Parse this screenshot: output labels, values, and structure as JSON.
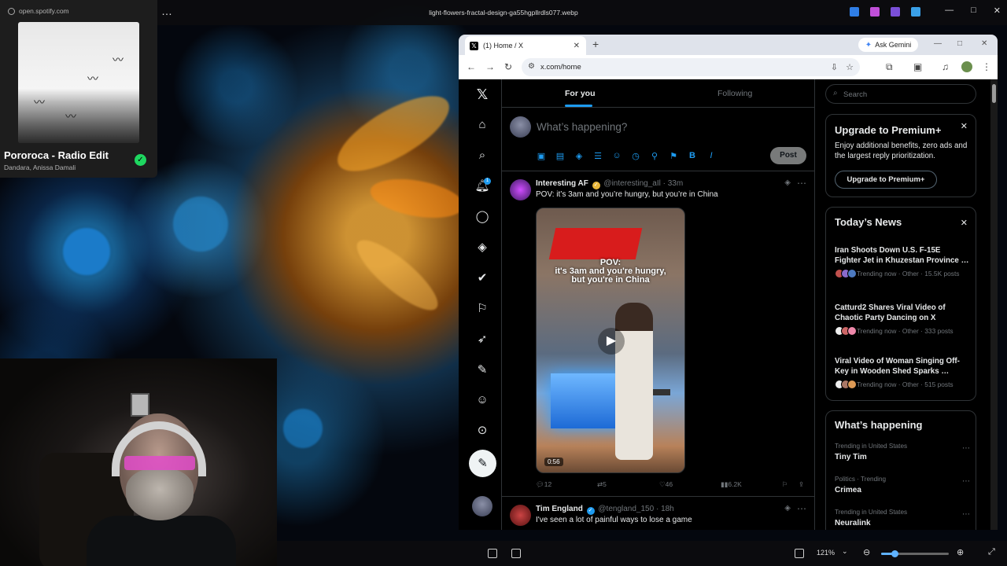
{
  "viewer": {
    "file_title": "light-flowers-fractal-design-ga55hgpllrdls077.webp",
    "menu_dots": "…",
    "zoom_level": "121%",
    "zoom_fraction": 0.2
  },
  "spotify": {
    "site": "open.spotify.com",
    "track_title": "Pororoca - Radio Edit",
    "artists": "Dandara, Anissa Damali",
    "liked": true
  },
  "browser": {
    "tab_title": "(1) Home / X",
    "ask_gemini_label": "Ask Gemini",
    "url": "x.com/home"
  },
  "x": {
    "tabs": [
      {
        "label": "For you",
        "active": true
      },
      {
        "label": "Following",
        "active": false
      }
    ],
    "composer_placeholder": "What’s happening?",
    "post_button": "Post",
    "nav_badge": "1",
    "tweets": [
      {
        "name": "Interesting AF",
        "handle": "@interesting_aIl",
        "time": "33m",
        "text": "POV: it’s 3am and you’re hungry, but you’re in China",
        "media_overlay": "POV:\nit's 3am and you're hungry,\nbut you're in China",
        "video_duration": "0:56",
        "replies": "12",
        "reposts": "5",
        "likes": "46",
        "views": "6.2K"
      },
      {
        "name": "Tim England",
        "handle": "@tengland_150",
        "time": "18h",
        "text": "I've seen a lot of painful ways to lose a game"
      }
    ],
    "search_placeholder": "Search",
    "premium": {
      "title": "Upgrade to Premium+",
      "description": "Enjoy additional benefits, zero ads and the largest reply prioritization.",
      "button": "Upgrade to Premium+"
    },
    "news": {
      "title": "Today’s News",
      "items": [
        {
          "headline": "Iran Shoots Down U.S. F-15E\nFighter Jet in Khuzestan Province …",
          "meta": "Trending now · Other · 15.5K posts"
        },
        {
          "headline": "Catturd2 Shares Viral Video of\nChaotic Party Dancing on X",
          "meta": "Trending now · Other · 333 posts"
        },
        {
          "headline": "Viral Video of Woman Singing Off-\nKey in Wooden Shed Sparks …",
          "meta": "Trending now · Other · 515 posts"
        }
      ]
    },
    "whats_happening": {
      "title": "What’s happening",
      "trends": [
        {
          "context": "Trending in United States",
          "topic": "Tiny Tim"
        },
        {
          "context": "Politics · Trending",
          "topic": "Crimea"
        },
        {
          "context": "Trending in United States",
          "topic": "Neuralink"
        }
      ]
    }
  },
  "icons": {
    "x_logo": "x-logo-icon",
    "home": "home-icon",
    "explore": "search-icon",
    "notifications": "bell-icon",
    "messages": "message-icon",
    "grok": "grok-icon",
    "verified": "verified-icon",
    "bookmarks": "bookmark-icon",
    "jobs": "rocket-icon",
    "articles": "edit-icon",
    "profile": "person-icon",
    "more": "more-icon"
  },
  "colors": {
    "x_blue": "#1d9bf0",
    "spotify_green": "#1ed760",
    "x_background": "#000000",
    "border": "#2f3336"
  }
}
